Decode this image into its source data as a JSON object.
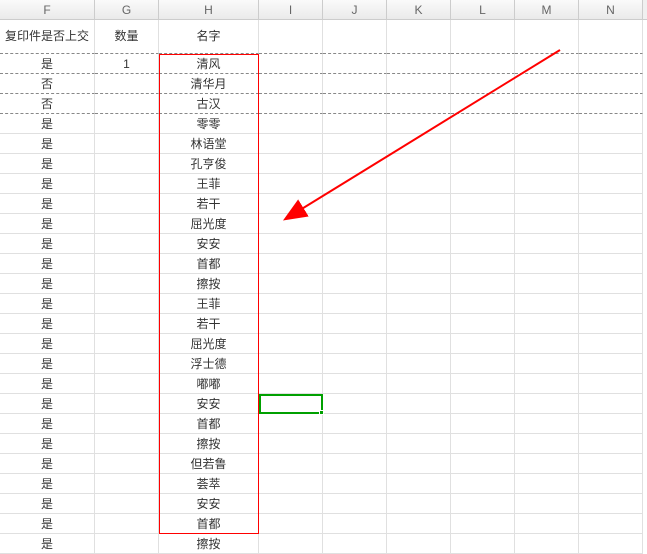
{
  "columns": [
    "F",
    "G",
    "H",
    "I",
    "J",
    "K",
    "L",
    "M",
    "N"
  ],
  "headers": {
    "F": "复印件是否上交",
    "G": "数量",
    "H": "名字"
  },
  "rows": [
    {
      "F": "是",
      "G": "1",
      "H": "清风"
    },
    {
      "F": "否",
      "G": "",
      "H": "清华月"
    },
    {
      "F": "否",
      "G": "",
      "H": "古汉"
    },
    {
      "F": "是",
      "G": "",
      "H": "零零"
    },
    {
      "F": "是",
      "G": "",
      "H": "林语堂"
    },
    {
      "F": "是",
      "G": "",
      "H": "孔亨俊"
    },
    {
      "F": "是",
      "G": "",
      "H": "王菲"
    },
    {
      "F": "是",
      "G": "",
      "H": "若干"
    },
    {
      "F": "是",
      "G": "",
      "H": "屈光度"
    },
    {
      "F": "是",
      "G": "",
      "H": "安安"
    },
    {
      "F": "是",
      "G": "",
      "H": "首都"
    },
    {
      "F": "是",
      "G": "",
      "H": "擦按"
    },
    {
      "F": "是",
      "G": "",
      "H": "王菲"
    },
    {
      "F": "是",
      "G": "",
      "H": "若干"
    },
    {
      "F": "是",
      "G": "",
      "H": "屈光度"
    },
    {
      "F": "是",
      "G": "",
      "H": "浮士德"
    },
    {
      "F": "是",
      "G": "",
      "H": "嘟嘟"
    },
    {
      "F": "是",
      "G": "",
      "H": "安安"
    },
    {
      "F": "是",
      "G": "",
      "H": "首都"
    },
    {
      "F": "是",
      "G": "",
      "H": "擦按"
    },
    {
      "F": "是",
      "G": "",
      "H": "但若鲁"
    },
    {
      "F": "是",
      "G": "",
      "H": "荟萃"
    },
    {
      "F": "是",
      "G": "",
      "H": "安安"
    },
    {
      "F": "是",
      "G": "",
      "H": "首都"
    },
    {
      "F": "是",
      "G": "",
      "H": "擦按"
    }
  ],
  "dashedRows": [
    0,
    1,
    2
  ],
  "selectedCell": "I18",
  "highlight": {
    "column": "H",
    "startRow": 1,
    "endRow": 25
  },
  "arrow": {
    "fromCol": "L",
    "toCol": "H",
    "color": "#ff0000"
  },
  "chart_data": null
}
